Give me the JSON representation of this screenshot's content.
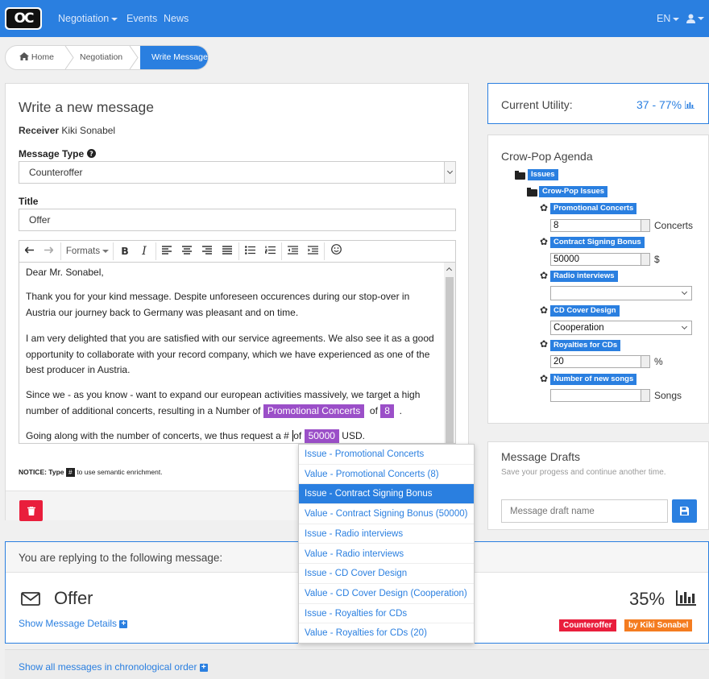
{
  "nav": {
    "logo_text": "OC",
    "menu": [
      {
        "label": "Negotiation",
        "has_caret": true
      },
      {
        "label": "Events"
      },
      {
        "label": "News"
      }
    ],
    "language": "EN",
    "accent": "#2a7fe0"
  },
  "breadcrumb": {
    "items": [
      "Home",
      "Negotiation"
    ],
    "active": "Write Message"
  },
  "compose": {
    "title": "Write a new message",
    "receiver_label": "Receiver",
    "receiver_name": "Kiki Sonabel",
    "type_label": "Message Type",
    "type_value": "Counteroffer",
    "title_label": "Title",
    "title_value": "Offer",
    "toolbar": {
      "formats": "Formats"
    },
    "body": {
      "greeting": "Dear Mr. Sonabel,",
      "p1": "Thank you for your kind message. Despite unforeseen occurences during our stop-over in Austria our journey back to Germany was pleasant and on time.",
      "p2": "I am very delighted that you are satisfied with our service agreements. We also see it as a good opportunity to collaborate with your record company, which we have experienced as one of the best producer in Austria.",
      "p3_a": "Since we - as you know - want to expand our european activities massively, we target a high number of additional concerts, resulting in a Number of",
      "p3_chip1": "Promotional Concerts",
      "p3_of": "of",
      "p3_chip2": "8",
      "p3_end": ".",
      "p4_a": "Going along with the number of concerts, we thus request a #",
      "p4_of": "of",
      "p4_chip": "50000",
      "p4_end": "USD."
    },
    "notice_a": "NOTICE: Type",
    "notice_key": "#",
    "notice_b": "to use semantic enrichment.",
    "delete_color": "#e91e3c"
  },
  "utility": {
    "label": "Current Utility:",
    "value": "37 - 77%"
  },
  "agenda": {
    "title": "Crow-Pop Agenda",
    "root": "Issues",
    "group": "Crow-Pop Issues",
    "issues": [
      {
        "name": "Promotional Concerts",
        "value": "8",
        "unit": "Concerts",
        "kind": "spin"
      },
      {
        "name": "Contract Signing Bonus",
        "value": "50000",
        "unit": "$",
        "kind": "spin"
      },
      {
        "name": "Radio interviews",
        "value": "",
        "unit": "",
        "kind": "select"
      },
      {
        "name": "CD Cover Design",
        "value": "Cooperation",
        "unit": "",
        "kind": "select"
      },
      {
        "name": "Royalties for CDs",
        "value": "20",
        "unit": "%",
        "kind": "spin"
      },
      {
        "name": "Number of new songs",
        "value": "",
        "unit": "Songs",
        "kind": "spin"
      }
    ]
  },
  "drafts": {
    "title": "Message Drafts",
    "subtitle": "Save your progess and continue another time.",
    "placeholder": "Message draft name"
  },
  "autocomplete": {
    "items": [
      "Issue - Promotional Concerts",
      "Value - Promotional Concerts (8)",
      "Issue - Contract Signing Bonus",
      "Value - Contract Signing Bonus (50000)",
      "Issue - Radio interviews",
      "Value - Radio interviews",
      "Issue - CD Cover Design",
      "Value - CD Cover Design (Cooperation)",
      "Issue - Royalties for CDs",
      "Value - Royalties for CDs (20)"
    ],
    "selected_index": 2
  },
  "reply": {
    "heading": "You are replying to the following message:",
    "title": "Offer",
    "details_link": "Show Message Details",
    "percent": "35%",
    "badge_type": "Counteroffer",
    "badge_from": "by Kiki Sonabel",
    "badge_type_color": "#e91e3c",
    "badge_from_color": "#f47c20"
  },
  "footer": {
    "link": "Show all messages in chronological order"
  }
}
